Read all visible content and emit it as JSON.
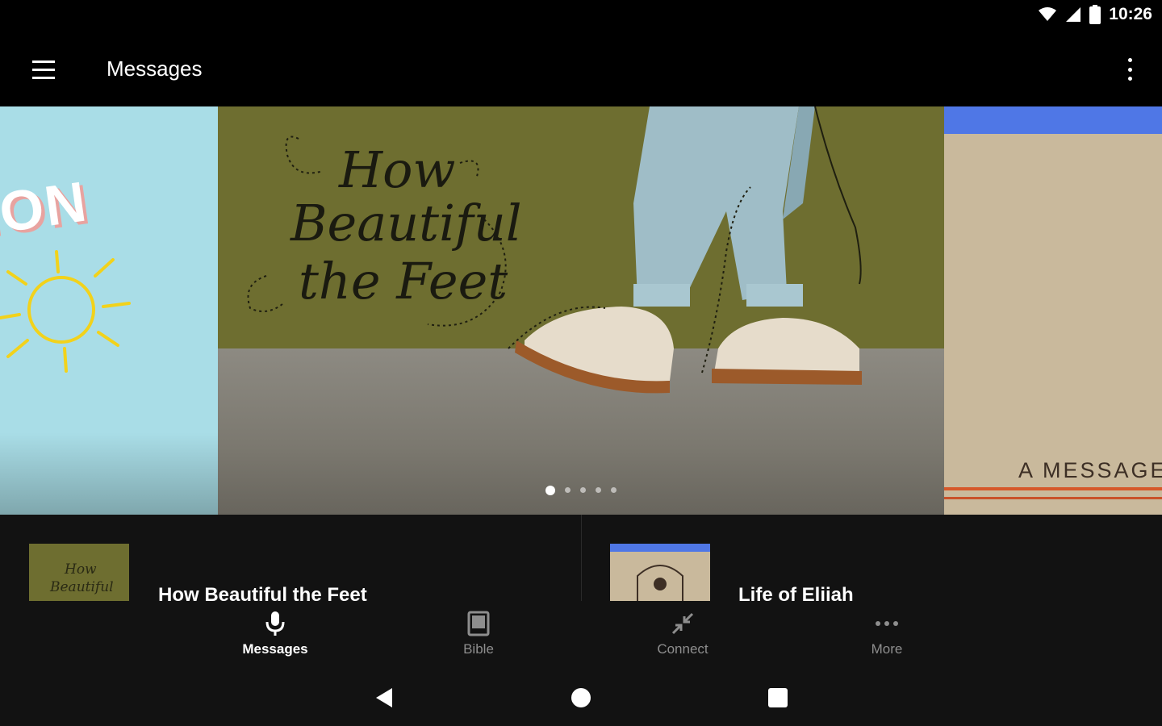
{
  "status_bar": {
    "time": "10:26"
  },
  "app_bar": {
    "title": "Messages"
  },
  "carousel": {
    "left_slide_text": "ION",
    "main_slide_script": [
      "How",
      "Beautiful",
      "the Feet"
    ],
    "right_slide_caption": "A MESSAGE",
    "active_index": 0,
    "page_count": 5
  },
  "list": {
    "items": [
      {
        "title": "How Beautiful the Feet",
        "thumb_text": [
          "How",
          "Beautiful"
        ]
      },
      {
        "title": "Life of Elijah"
      }
    ]
  },
  "bottom_nav": {
    "items": [
      {
        "label": "Messages",
        "icon": "microphone-icon",
        "active": true
      },
      {
        "label": "Bible",
        "icon": "book-icon",
        "active": false
      },
      {
        "label": "Connect",
        "icon": "connect-arrows-icon",
        "active": false
      },
      {
        "label": "More",
        "icon": "more-horizontal-icon",
        "active": false
      }
    ]
  },
  "system_nav": {
    "buttons": [
      "back-icon",
      "home-icon",
      "recents-icon"
    ]
  },
  "colors": {
    "background": "#000000",
    "surface": "#121212",
    "nav_inactive": "#8e8e8e",
    "main_slide_olive": "#6e6e30",
    "left_slide_blue": "#a9dde7",
    "right_slide_tan": "#c9b99c",
    "right_slide_band": "#4f77e6"
  }
}
